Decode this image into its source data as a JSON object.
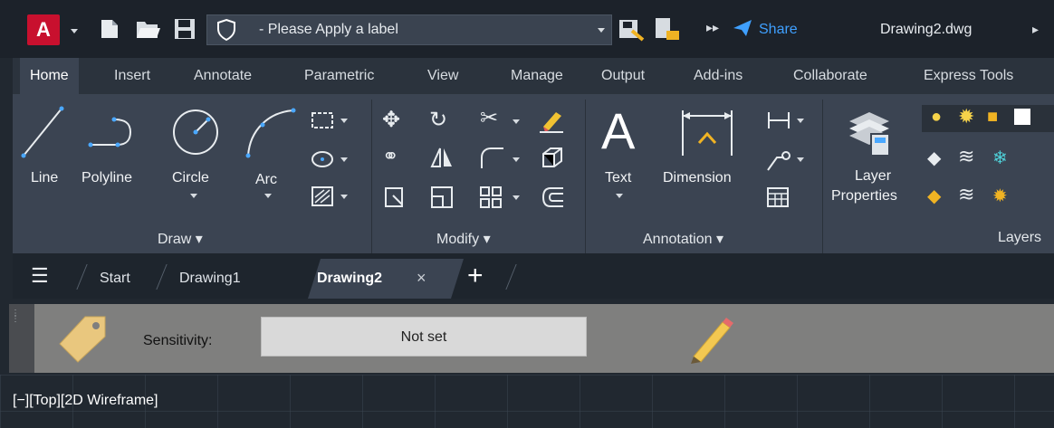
{
  "title_bar": {
    "app_letter": "A",
    "label_text": "- Please Apply a label",
    "share_label": "Share",
    "file_name": "Drawing2.dwg"
  },
  "ribbon_tabs": [
    "Home",
    "Insert",
    "Annotate",
    "Parametric",
    "View",
    "Manage",
    "Output",
    "Add-ins",
    "Collaborate",
    "Express Tools"
  ],
  "active_tab": "Home",
  "draw_panel": {
    "title": "Draw",
    "tools": {
      "line": "Line",
      "polyline": "Polyline",
      "circle": "Circle",
      "arc": "Arc"
    }
  },
  "modify_panel": {
    "title": "Modify"
  },
  "annotation_panel": {
    "title": "Annotation",
    "tools": {
      "text": "Text",
      "dimension": "Dimension"
    }
  },
  "layers_panel": {
    "title": "Layers",
    "tools": {
      "layer_properties_line1": "Layer",
      "layer_properties_line2": "Properties"
    }
  },
  "file_tabs": {
    "start": "Start",
    "drawing1": "Drawing1",
    "drawing2": "Drawing2",
    "close_glyph": "×",
    "new_glyph": "+"
  },
  "sensitivity": {
    "label": "Sensitivity:",
    "value": "Not set"
  },
  "viewport": {
    "label": "[−][Top][2D Wireframe]"
  },
  "colors": {
    "app_red": "#c8102e",
    "share_blue": "#3fa0ff",
    "ribbon_bg": "#3b4452",
    "titlebar_bg": "#1c222a",
    "sensbar_bg": "#7f7f7e"
  }
}
